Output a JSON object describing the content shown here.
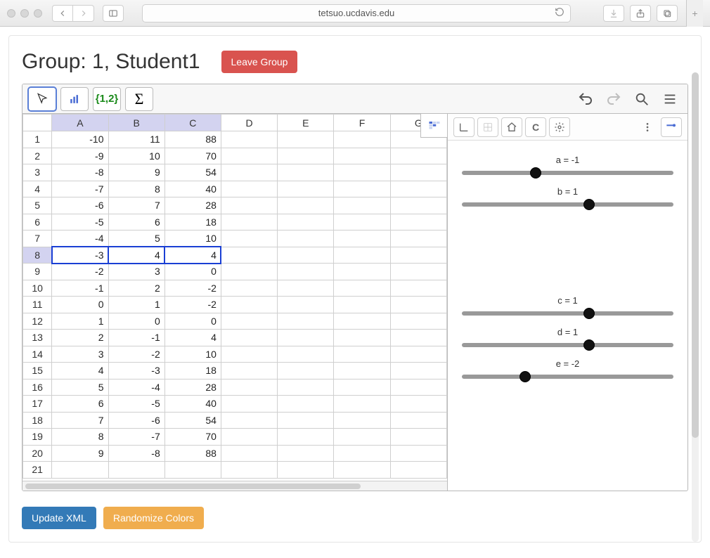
{
  "browser": {
    "url": "tetsuo.ucdavis.edu"
  },
  "header": {
    "title": "Group: 1, Student1",
    "leave_label": "Leave Group"
  },
  "toolbar": {
    "list_label": "{1,2}",
    "sigma_label": "Σ"
  },
  "spreadsheet": {
    "columns": [
      "A",
      "B",
      "C",
      "D",
      "E",
      "F",
      "G"
    ],
    "highlighted_cols": [
      "A",
      "B",
      "C"
    ],
    "selected_row": 8,
    "rows": [
      {
        "n": 1,
        "A": "-10",
        "B": "11",
        "C": "88"
      },
      {
        "n": 2,
        "A": "-9",
        "B": "10",
        "C": "70"
      },
      {
        "n": 3,
        "A": "-8",
        "B": "9",
        "C": "54"
      },
      {
        "n": 4,
        "A": "-7",
        "B": "8",
        "C": "40"
      },
      {
        "n": 5,
        "A": "-6",
        "B": "7",
        "C": "28"
      },
      {
        "n": 6,
        "A": "-5",
        "B": "6",
        "C": "18"
      },
      {
        "n": 7,
        "A": "-4",
        "B": "5",
        "C": "10"
      },
      {
        "n": 8,
        "A": "-3",
        "B": "4",
        "C": "4"
      },
      {
        "n": 9,
        "A": "-2",
        "B": "3",
        "C": "0"
      },
      {
        "n": 10,
        "A": "-1",
        "B": "2",
        "C": "-2"
      },
      {
        "n": 11,
        "A": "0",
        "B": "1",
        "C": "-2"
      },
      {
        "n": 12,
        "A": "1",
        "B": "0",
        "C": "0"
      },
      {
        "n": 13,
        "A": "2",
        "B": "-1",
        "C": "4"
      },
      {
        "n": 14,
        "A": "3",
        "B": "-2",
        "C": "10"
      },
      {
        "n": 15,
        "A": "4",
        "B": "-3",
        "C": "18"
      },
      {
        "n": 16,
        "A": "5",
        "B": "-4",
        "C": "28"
      },
      {
        "n": 17,
        "A": "6",
        "B": "-5",
        "C": "40"
      },
      {
        "n": 18,
        "A": "7",
        "B": "-6",
        "C": "54"
      },
      {
        "n": 19,
        "A": "8",
        "B": "-7",
        "C": "70"
      },
      {
        "n": 20,
        "A": "9",
        "B": "-8",
        "C": "88"
      },
      {
        "n": 21,
        "A": "",
        "B": "",
        "C": ""
      }
    ]
  },
  "sliders": [
    {
      "id": "a",
      "label": "a = -1",
      "pos": 0.35
    },
    {
      "id": "b",
      "label": "b = 1",
      "pos": 0.6
    },
    {
      "gap": true
    },
    {
      "id": "c",
      "label": "c = 1",
      "pos": 0.6
    },
    {
      "id": "d",
      "label": "d = 1",
      "pos": 0.6
    },
    {
      "id": "e",
      "label": "e = -2",
      "pos": 0.3
    }
  ],
  "footer": {
    "update_label": "Update XML",
    "randomize_label": "Randomize Colors"
  }
}
